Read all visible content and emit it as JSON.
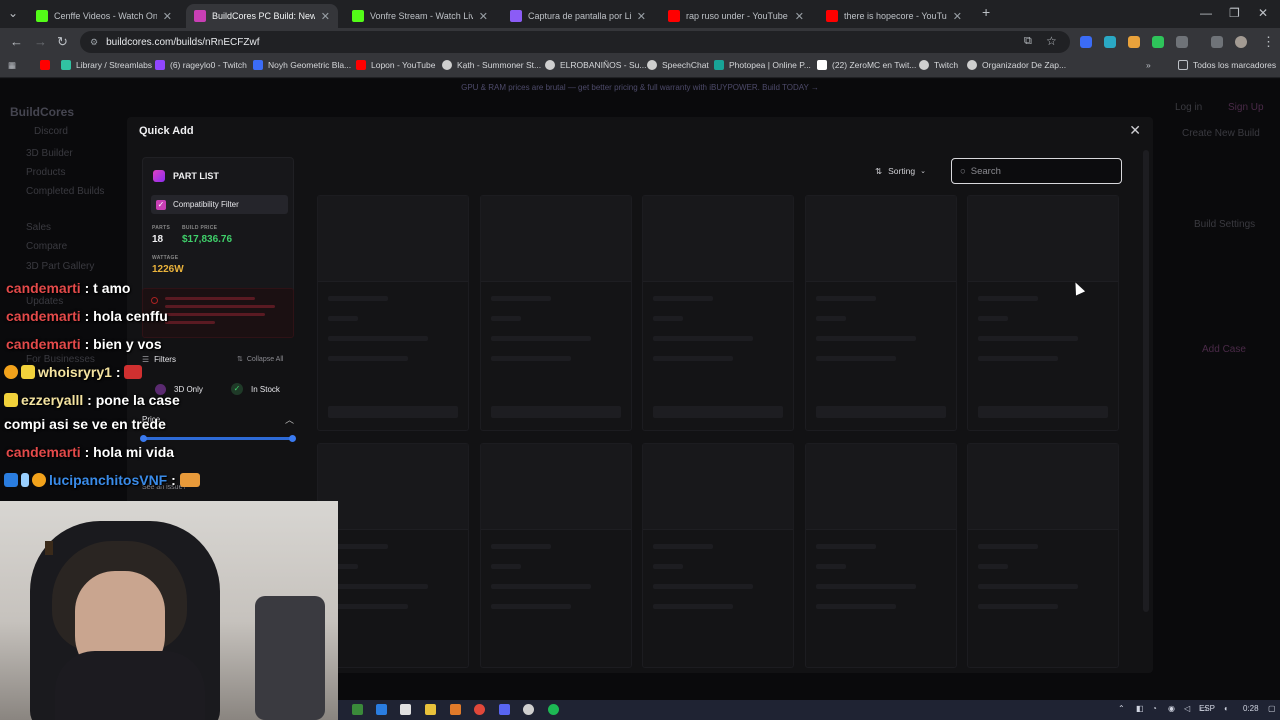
{
  "browser": {
    "tabs": [
      {
        "title": "Cenffe Videos - Watch On-Dem",
        "color": "#53fc18"
      },
      {
        "title": "BuildCores PC Build: New Build",
        "color": "#c93fb5"
      },
      {
        "title": "Vonfre Stream - Watch Live",
        "color": "#53fc18"
      },
      {
        "title": "Captura de pantalla por Lightsh",
        "color": "#8b5cf6"
      },
      {
        "title": "rap ruso under - YouTube",
        "color": "#ff0000"
      },
      {
        "title": "there is hopecore - YouTub",
        "color": "#ff0000"
      }
    ],
    "url": "buildcores.com/builds/nRnECFZwf",
    "bookmarks": [
      {
        "label": "Library / Streamlabs",
        "color": "#31c3a2"
      },
      {
        "label": "(6) rageylo0 - Twitch",
        "color": "#9146ff"
      },
      {
        "label": "Noyh Geometric Bla...",
        "color": "#3b6cf6"
      },
      {
        "label": "Lopon - YouTube",
        "color": "#ff0000"
      },
      {
        "label": "Kạth - Summoner St...",
        "color": "#cfcfcf"
      },
      {
        "label": "ELROBANIÑOS - Su...",
        "color": "#cfcfcf"
      },
      {
        "label": "SpeechChat",
        "color": "#cfcfcf"
      },
      {
        "label": "Photopea | Online P...",
        "color": "#18a497"
      },
      {
        "label": "(22) ZeroMC en Twit...",
        "color": "#ffffff"
      },
      {
        "label": "Twitch",
        "color": "#cfcfcf"
      },
      {
        "label": "Organizador De Zap...",
        "color": "#cfcfcf"
      }
    ],
    "all_bookmarks": "Todos los marcadores"
  },
  "page": {
    "promo": "GPU & RAM prices are brutal — get better pricing & full warranty with iBUYPOWER. Build TODAY →",
    "brand": "BuildCores",
    "sidebar": [
      "3D Builder",
      "Products",
      "Completed Builds",
      "Sales",
      "Compare",
      "3D Part Gallery",
      "Updates",
      "For Businesses"
    ],
    "discord": "Discord",
    "login": "Log in",
    "signup": "Sign Up",
    "create_build": "Create New Build",
    "build_settings": "Build Settings",
    "add_case": "Add Case"
  },
  "modal": {
    "title": "Quick Add",
    "part_list": {
      "heading": "PART LIST",
      "compat_filter": "Compatibility Filter",
      "parts_label": "PARTS",
      "parts_value": "18",
      "price_label": "BUILD PRICE",
      "price_value": "$17,836.76",
      "wattage_label": "WATTAGE",
      "wattage_value": "1226W"
    },
    "filters_label": "Filters",
    "collapse_all": "Collapse All",
    "only_3d": "3D Only",
    "in_stock": "In Stock",
    "price_label": "Price",
    "see_issue": "See an issue?",
    "sorting": "Sorting",
    "search_placeholder": "Search"
  },
  "chat": [
    {
      "user": "candemarti",
      "msg": ": t amo",
      "color": "red"
    },
    {
      "user": "candemarti",
      "msg": ": hola cenffu",
      "color": "red"
    },
    {
      "user": "candemarti",
      "msg": ": bien y vos",
      "color": "red"
    },
    {
      "user": "whoisryry1",
      "msg": ":",
      "color": "gold"
    },
    {
      "user": "ezzeryalll",
      "msg": ": pone la case",
      "color": "gold"
    },
    {
      "user": "",
      "msg": "compi asi se ve en trede",
      "color": "white"
    },
    {
      "user": "candemarti",
      "msg": ": hola mi vida",
      "color": "red"
    },
    {
      "user": "lucipanchitosVNF",
      "msg": ":",
      "color": "blue"
    }
  ],
  "taskbar": {
    "lang": "ESP",
    "time": "0:28"
  }
}
